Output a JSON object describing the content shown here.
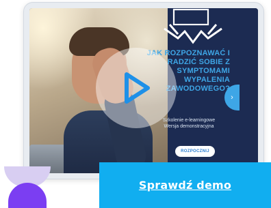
{
  "slide": {
    "heading": "JAK ROZPOZNAWAĆ I RADZIĆ SOBIE Z SYMPTOMAMI WYPALENIA ZAWODOWEGO?",
    "subtitle_line1": "Szkolenie e-learningowe",
    "subtitle_line2": "Wersja demonstracyjna",
    "start_button": "ROZPOCZNIJ",
    "side_button_icon": "chevron-right-icon"
  },
  "player": {
    "play_icon": "play-icon"
  },
  "cta": {
    "label": "Sprawdź demo"
  },
  "colors": {
    "accent_blue": "#11aef0",
    "panel_navy": "#1c2b52",
    "heading_blue": "#3ea6e6",
    "purple": "#7b3ef2",
    "lavender": "#d8cef2"
  }
}
